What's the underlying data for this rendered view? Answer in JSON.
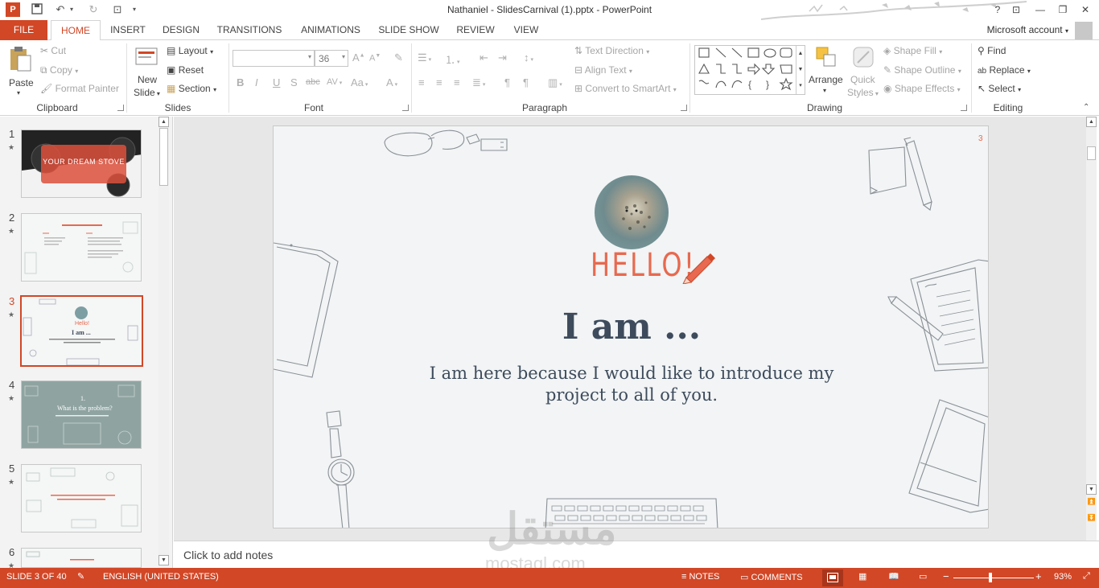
{
  "window": {
    "title": "Nathaniel - SlidesCarnival (1).pptx - PowerPoint",
    "help": "?",
    "controls": [
      "⊡",
      "—",
      "❐",
      "✕"
    ]
  },
  "tabs": {
    "file": "FILE",
    "items": [
      "HOME",
      "INSERT",
      "DESIGN",
      "TRANSITIONS",
      "ANIMATIONS",
      "SLIDE SHOW",
      "REVIEW",
      "VIEW"
    ],
    "active": "HOME",
    "account": "Microsoft account"
  },
  "ribbon": {
    "clipboard": {
      "label": "Clipboard",
      "paste": "Paste",
      "cut": "Cut",
      "copy": "Copy",
      "format_painter": "Format Painter"
    },
    "slides": {
      "label": "Slides",
      "new_slide_line1": "New",
      "new_slide_line2": "Slide",
      "layout": "Layout",
      "reset": "Reset",
      "section": "Section"
    },
    "font": {
      "label": "Font",
      "font_name": "",
      "font_size": "36",
      "bold": "B",
      "italic": "I",
      "underline": "U",
      "shadow": "S",
      "strike": "abc",
      "spacing": "AV",
      "case": "Aa",
      "color": "A",
      "grow": "A",
      "shrink": "A"
    },
    "paragraph": {
      "label": "Paragraph",
      "text_direction": "Text Direction",
      "align_text": "Align Text",
      "convert_smartart": "Convert to SmartArt"
    },
    "drawing": {
      "label": "Drawing",
      "arrange": "Arrange",
      "quick_styles_line1": "Quick",
      "quick_styles_line2": "Styles",
      "shape_fill": "Shape Fill",
      "shape_outline": "Shape Outline",
      "shape_effects": "Shape Effects"
    },
    "editing": {
      "label": "Editing",
      "find": "Find",
      "replace": "Replace",
      "select": "Select"
    }
  },
  "slides_panel": {
    "thumbs": [
      {
        "num": "1",
        "text": "YOUR DREAM STOVE"
      },
      {
        "num": "2",
        "text": ""
      },
      {
        "num": "3",
        "text": ""
      },
      {
        "num": "4",
        "text": ""
      },
      {
        "num": "5",
        "text": ""
      },
      {
        "num": "6",
        "text": ""
      }
    ],
    "selected": "3"
  },
  "slide": {
    "hello": "HELLO!",
    "title": "I am ...",
    "subtitle_line1": "I am here because I would like to introduce my",
    "subtitle_line2": "project to all of you.",
    "page_num": "3"
  },
  "notes": {
    "placeholder": "Click to add notes"
  },
  "status": {
    "slide_info": "SLIDE 3 OF 40",
    "language": "ENGLISH (UNITED STATES)",
    "notes": "NOTES",
    "comments": "COMMENTS",
    "zoom": "93%"
  },
  "colors": {
    "accent": "#d24726",
    "slide_bg": "#f2f4f5",
    "title_text": "#3d4b5c",
    "hello_red": "#e8694f"
  },
  "watermark": {
    "arabic": "مستقل",
    "latin": "mostaql.com"
  }
}
